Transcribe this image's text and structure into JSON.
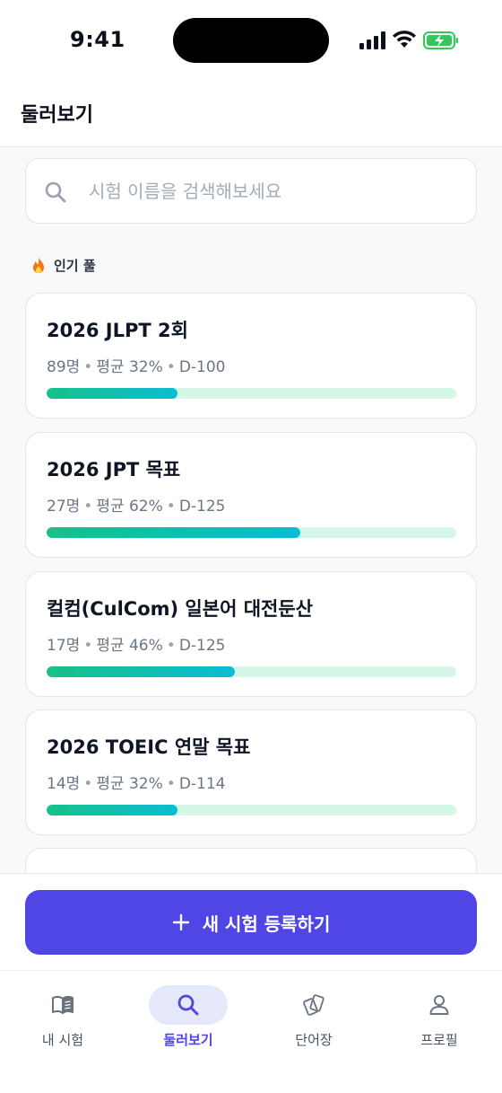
{
  "status_bar": {
    "time": "9:41"
  },
  "header": {
    "title": "둘러보기"
  },
  "search": {
    "placeholder": "시험 이름을 검색해보세요"
  },
  "section": {
    "label": "인기 풀"
  },
  "cards": [
    {
      "title": "2026 JLPT 2회",
      "members": "89명",
      "average": "평균 32%",
      "dday": "D-100",
      "progress": 0.32
    },
    {
      "title": "2026 JPT 목표",
      "members": "27명",
      "average": "평균 62%",
      "dday": "D-125",
      "progress": 0.62
    },
    {
      "title": "컬컴(CulCom) 일본어 대전둔산",
      "members": "17명",
      "average": "평균 46%",
      "dday": "D-125",
      "progress": 0.46
    },
    {
      "title": "2026 TOEIC 연말 목표",
      "members": "14명",
      "average": "평균 32%",
      "dday": "D-114",
      "progress": 0.32
    }
  ],
  "register_button": {
    "label": "새 시험 등록하기",
    "icon": "plus-icon"
  },
  "tabs": [
    {
      "label": "내 시험",
      "icon": "book-icon",
      "active": false
    },
    {
      "label": "둘러보기",
      "icon": "search-icon",
      "active": true
    },
    {
      "label": "단어장",
      "icon": "cards-icon",
      "active": false
    },
    {
      "label": "프로필",
      "icon": "person-icon",
      "active": false
    }
  ],
  "colors": {
    "accent": "#4f46e5",
    "progress_start": "#16c188",
    "progress_end": "#0bbcd4",
    "progress_track": "#d4f7e7",
    "battery": "#34c759"
  }
}
